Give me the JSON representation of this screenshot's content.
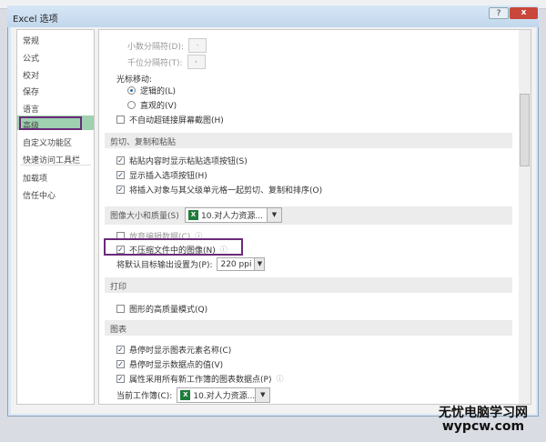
{
  "dialog": {
    "title": "Excel 选项",
    "help": "?",
    "close": "x"
  },
  "nav": [
    "常规",
    "公式",
    "校对",
    "保存",
    "语言",
    "高级",
    "自定义功能区",
    "快速访问工具栏",
    "加载项",
    "信任中心"
  ],
  "editing": {
    "decimal_label": "小数分隔符(D):",
    "decimal_value": ".",
    "thousands_label": "千位分隔符(T):",
    "thousands_value": ",",
    "cursor_label": "光标移动:",
    "logical": "逻辑的(L)",
    "visual": "直观的(V)",
    "no_hyperlink": "不自动超链接屏幕截图(H)"
  },
  "cut_section": {
    "title": "剪切、复制和粘贴",
    "items": [
      "粘贴内容时显示粘贴选项按钮(S)",
      "显示插入选项按钮(H)",
      "将插入对象与其父级单元格一起剪切、复制和排序(O)"
    ]
  },
  "image_section": {
    "title": "图像大小和质量(S)",
    "workbook": "10.对人力资源...",
    "discard": "放弃编辑数据(C)",
    "no_compress": "不压缩文件中的图像(N)",
    "default_output_label": "将默认目标输出设置为(P):",
    "default_output_value": "220 ppi"
  },
  "print_section": {
    "title": "打印",
    "item": "图形的高质量模式(Q)"
  },
  "chart_section": {
    "title": "图表",
    "items": [
      "悬停时显示图表元素名称(C)",
      "悬停时显示数据点的值(V)",
      "属性采用所有新工作簿的图表数据点(P)"
    ],
    "current_label": "当前工作簿(C):",
    "current_value": "10.对人力资源..."
  },
  "watermark": {
    "line1": "无忧电脑学习网",
    "line2": "wypcw.com"
  }
}
